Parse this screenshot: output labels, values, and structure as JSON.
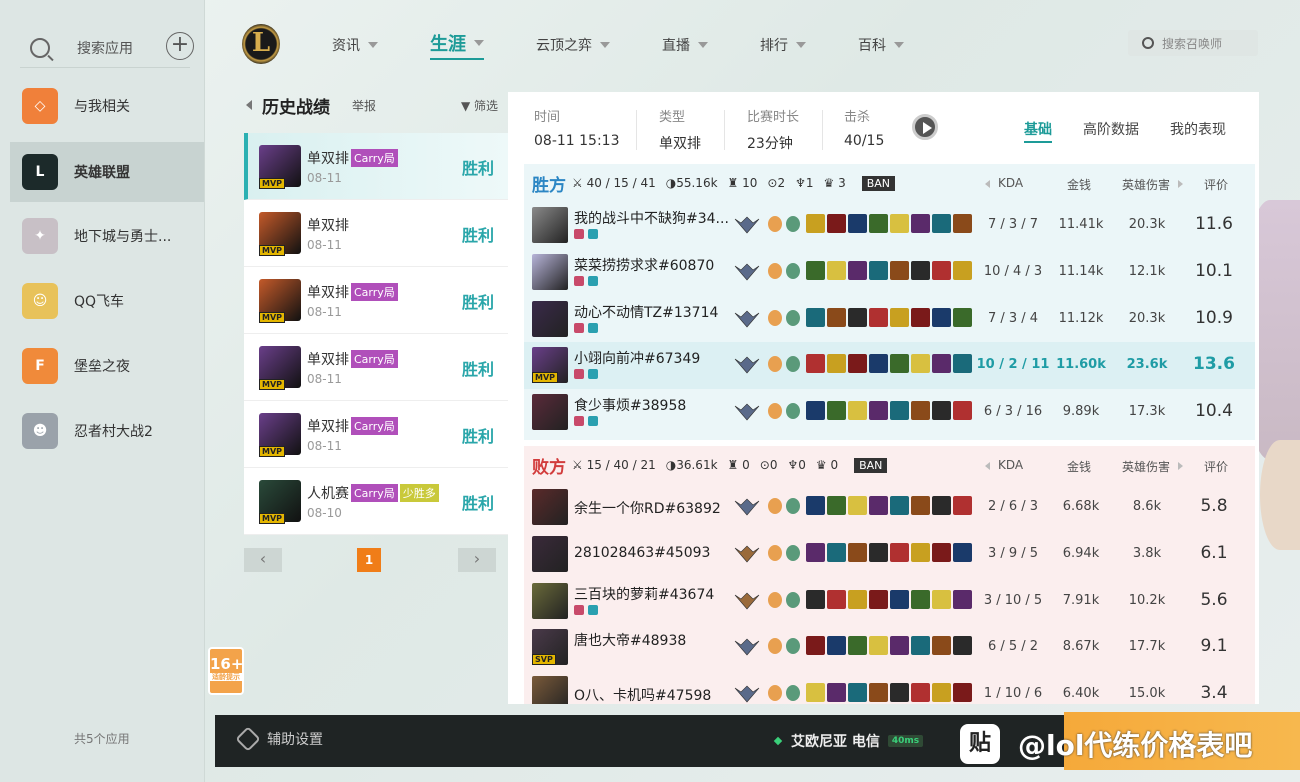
{
  "sidebar": {
    "search_label": "搜索应用",
    "apps": [
      {
        "label": "与我相关",
        "color": "#f0803a",
        "glyph": "◇"
      },
      {
        "label": "英雄联盟",
        "color": "#1c2a2a",
        "glyph": "L"
      },
      {
        "label": "地下城与勇士...",
        "color": "#c8c0c6",
        "glyph": "✦"
      },
      {
        "label": "QQ飞车",
        "color": "#e8c25a",
        "glyph": "☺"
      },
      {
        "label": "堡垒之夜",
        "color": "#f08a3a",
        "glyph": "F"
      },
      {
        "label": "忍者村大战2",
        "color": "#9aa2aa",
        "glyph": "☻"
      }
    ],
    "count_label": "共5个应用"
  },
  "age_rating": {
    "value": "16+",
    "label": "适龄提示"
  },
  "nav": {
    "items": [
      "资讯",
      "生涯",
      "云顶之弈",
      "直播",
      "排行",
      "百科"
    ],
    "active": "生涯",
    "search_placeholder": "搜索召唤师"
  },
  "history": {
    "title": "历史战绩",
    "report": "举报",
    "filter": "筛选",
    "items": [
      {
        "mode": "单双排",
        "tag": "Carry局",
        "tag2": "",
        "date": "08-11",
        "result": "胜利",
        "color": "#6a3f8a"
      },
      {
        "mode": "单双排",
        "tag": "",
        "tag2": "",
        "date": "08-11",
        "result": "胜利",
        "color": "#c45a2a"
      },
      {
        "mode": "单双排",
        "tag": "Carry局",
        "tag2": "",
        "date": "08-11",
        "result": "胜利",
        "color": "#c45a2a"
      },
      {
        "mode": "单双排",
        "tag": "Carry局",
        "tag2": "",
        "date": "08-11",
        "result": "胜利",
        "color": "#6a3f8a"
      },
      {
        "mode": "单双排",
        "tag": "Carry局",
        "tag2": "",
        "date": "08-11",
        "result": "胜利",
        "color": "#6a3f8a"
      },
      {
        "mode": "人机赛",
        "tag": "Carry局",
        "tag2": "少胜多",
        "date": "08-10",
        "result": "胜利",
        "color": "#2a4a3a"
      }
    ],
    "mvp_label": "MVP",
    "page": "1"
  },
  "match": {
    "time_label": "时间",
    "time": "08-11 15:13",
    "type_label": "类型",
    "type": "单双排",
    "duration_label": "比赛时长",
    "duration": "23分钟",
    "kills_label": "击杀",
    "kills": "40/15",
    "tabs": [
      "基础",
      "高阶数据",
      "我的表现"
    ],
    "columns": {
      "kda": "KDA",
      "gold": "金钱",
      "dmg": "英雄伤害",
      "score": "评价"
    },
    "ban": "BAN"
  },
  "win_team": {
    "name": "胜方",
    "kda": "40 / 15 / 41",
    "gold": "55.16k",
    "towers": "10",
    "dragons": "2",
    "barons": "1",
    "heralds": "3",
    "players": [
      {
        "name": "我的战斗中不缺狗#34...",
        "kda": "7 / 3 / 7",
        "gold": "11.41k",
        "dmg": "20.3k",
        "score": "11.6",
        "color": "#8a8a8a",
        "badge": ""
      },
      {
        "name": "菜菜捞捞求求#60870",
        "kda": "10 / 4 / 3",
        "gold": "11.14k",
        "dmg": "12.1k",
        "score": "10.1",
        "color": "#b7b4d9",
        "badge": ""
      },
      {
        "name": "动心不动情TZ#13714",
        "kda": "7 / 3 / 4",
        "gold": "11.12k",
        "dmg": "20.3k",
        "score": "10.9",
        "color": "#3a2a4a",
        "badge": ""
      },
      {
        "name": "小翊向前冲#67349",
        "kda": "10 / 2 / 11",
        "gold": "11.60k",
        "dmg": "23.6k",
        "score": "13.6",
        "color": "#6a3f8a",
        "badge": "MVP"
      },
      {
        "name": "食少事烦#38958",
        "kda": "6 / 3 / 16",
        "gold": "9.89k",
        "dmg": "17.3k",
        "score": "10.4",
        "color": "#5a2a3a",
        "badge": ""
      }
    ]
  },
  "lose_team": {
    "name": "败方",
    "kda": "15 / 40 / 21",
    "gold": "36.61k",
    "towers": "0",
    "dragons": "0",
    "barons": "0",
    "heralds": "0",
    "players": [
      {
        "name": "余生一个你RD#63892",
        "kda": "2 / 6 / 3",
        "gold": "6.68k",
        "dmg": "8.6k",
        "score": "5.8",
        "color": "#5a2a2a",
        "badge": ""
      },
      {
        "name": "281028463#45093",
        "kda": "3 / 9 / 5",
        "gold": "6.94k",
        "dmg": "3.8k",
        "score": "6.1",
        "color": "#3a2a3a",
        "badge": ""
      },
      {
        "name": "三百块的萝莉#43674",
        "kda": "3 / 10 / 5",
        "gold": "7.91k",
        "dmg": "10.2k",
        "score": "5.6",
        "color": "#6a6a3a",
        "badge": ""
      },
      {
        "name": "唐也大帝#48938",
        "kda": "6 / 5 / 2",
        "gold": "8.67k",
        "dmg": "17.7k",
        "score": "9.1",
        "color": "#4a3a4a",
        "badge": "SVP"
      },
      {
        "name": "O八、卡机吗#47598",
        "kda": "1 / 10 / 6",
        "gold": "6.40k",
        "dmg": "15.0k",
        "score": "3.4",
        "color": "#7a5a3a",
        "badge": ""
      }
    ]
  },
  "bottom": {
    "settings": "辅助设置",
    "server": "艾欧尼亚 电信",
    "ping": "40ms"
  },
  "watermark": {
    "logo": "贴",
    "text": "@lol代练价格表吧"
  },
  "item_palette": [
    "#c8a020",
    "#7a1a1a",
    "#1a3a6a",
    "#3a6a2a",
    "#d8c040",
    "#5a2a6a",
    "#1a6a7a",
    "#8a4a1a",
    "#2a2a2a",
    "#b03030"
  ]
}
